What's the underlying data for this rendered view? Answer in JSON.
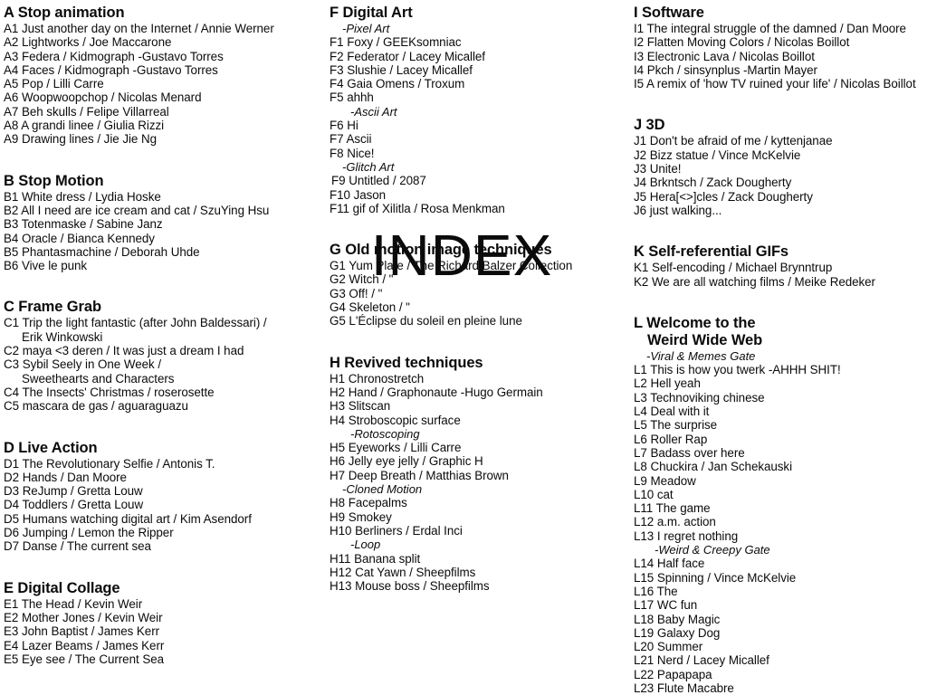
{
  "title": "INDEX",
  "columns": [
    {
      "id": "column-1",
      "sections": [
        {
          "letter": "A",
          "heading": "A Stop animation",
          "entries": [
            {
              "text": "A1 Just another day on the Internet / Annie Werner"
            },
            {
              "text": "A2 Lightworks / Joe Maccarone"
            },
            {
              "text": "A3 Federa / Kidmograph -Gustavo Torres"
            },
            {
              "text": "A4 Faces / Kidmograph -Gustavo Torres"
            },
            {
              "text": "A5 Pop / Lilli Carre"
            },
            {
              "text": "A6 Woopwoopchop / Nicolas Menard"
            },
            {
              "text": "A7 Beh skulls / Felipe Villarreal"
            },
            {
              "text": "A8 A grandi linee / Giulia Rizzi"
            },
            {
              "text": "A9 Drawing lines / Jie Jie Ng"
            }
          ]
        },
        {
          "letter": "B",
          "heading": "B Stop Motion",
          "entries": [
            {
              "text": "B1 White dress / Lydia Hoske"
            },
            {
              "text": "B2 All I need are ice cream and cat / SzuYing Hsu"
            },
            {
              "text": "B3 Totenmaske / Sabine Janz"
            },
            {
              "text": "B4 Oracle / Bianca Kennedy"
            },
            {
              "text": "B5 Phantasmachine / Deborah Uhde"
            },
            {
              "text": "B6 Vive le punk"
            }
          ]
        },
        {
          "letter": "C",
          "heading": "C Frame Grab",
          "entries": [
            {
              "text": "C1 Trip the light fantastic (after John Baldessari) /",
              "cont": "Erik Winkowski"
            },
            {
              "text": "C2 maya <3 deren / It was just a dream I had"
            },
            {
              "text": "C3 Sybil Seely in One Week /",
              "cont": "Sweethearts and Characters"
            },
            {
              "text": "C4 The Insects' Christmas / roserosette"
            },
            {
              "text": "C5 mascara de gas / aguaraguazu"
            }
          ]
        },
        {
          "letter": "D",
          "heading": "D Live Action",
          "entries": [
            {
              "text": "D1 The Revolutionary Selfie / Antonis T."
            },
            {
              "text": "D2 Hands / Dan Moore"
            },
            {
              "text": "D3 ReJump / Gretta Louw"
            },
            {
              "text": "D4 Toddlers / Gretta Louw"
            },
            {
              "text": "D5 Humans watching digital art / Kim Asendorf"
            },
            {
              "text": "D6 Jumping / Lemon the Ripper"
            },
            {
              "text": "D7 Danse / The current sea"
            }
          ]
        },
        {
          "letter": "E",
          "heading": "E Digital Collage",
          "entries": [
            {
              "text": "E1 The Head / Kevin Weir"
            },
            {
              "text": "E2 Mother Jones / Kevin Weir"
            },
            {
              "text": "E3 John Baptist / James Kerr"
            },
            {
              "text": "E4 Lazer Beams / James Kerr"
            },
            {
              "text": "E5 Eye see / The Current Sea"
            }
          ]
        }
      ]
    },
    {
      "id": "column-2",
      "sections": [
        {
          "letter": "F",
          "heading": "F Digital Art",
          "subhead": "-Pixel Art",
          "entries": [
            {
              "text": "F1 Foxy / GEEKsomniac"
            },
            {
              "text": "F2 Federator / Lacey Micallef"
            },
            {
              "text": "F3 Slushie / Lacey Micallef"
            },
            {
              "text": "F4 Gaia Omens / Troxum"
            },
            {
              "text": "F5 ahhh"
            },
            {
              "subhead": "-Ascii Art",
              "deep": true
            },
            {
              "text": "F6 Hi"
            },
            {
              "text": "F7 Ascii"
            },
            {
              "text": "F8 Nice!"
            },
            {
              "subhead": "-Glitch Art"
            },
            {
              "text": "F9 Untitled / 2087",
              "nudge": true
            },
            {
              "text": "F10 Jason"
            },
            {
              "text": "F11 gif of Xilitla / Rosa Menkman"
            }
          ]
        },
        {
          "letter": "G",
          "heading": "G Old motion image techniques",
          "entries": [
            {
              "text": "G1 Yum Plate / The Richard Balzer Collection"
            },
            {
              "text": "G2 Witch / \""
            },
            {
              "text": "G3 Off! / \""
            },
            {
              "text": "G4 Skeleton / \""
            },
            {
              "text": "G5 L'Éclipse du soleil en pleine lune"
            }
          ]
        },
        {
          "letter": "H",
          "heading": "H Revived techniques",
          "entries": [
            {
              "text": "H1 Chronostretch"
            },
            {
              "text": "H2 Hand / Graphonaute -Hugo Germain"
            },
            {
              "text": "H3 Slitscan"
            },
            {
              "text": "H4 Stroboscopic surface"
            },
            {
              "subhead": "-Rotoscoping",
              "deep": true
            },
            {
              "text": "H5 Eyeworks / Lilli Carre"
            },
            {
              "text": "H6 Jelly eye jelly / Graphic H"
            },
            {
              "text": "H7 Deep Breath / Matthias Brown"
            },
            {
              "subhead": "-Cloned Motion"
            },
            {
              "text": "H8 Facepalms"
            },
            {
              "text": "H9 Smokey"
            },
            {
              "text": "H10 Berliners / Erdal Inci"
            },
            {
              "subhead": "-Loop",
              "deep": true
            },
            {
              "text": "H11 Banana split"
            },
            {
              "text": "H12 Cat Yawn / Sheepfilms"
            },
            {
              "text": "H13 Mouse boss / Sheepfilms"
            }
          ]
        }
      ]
    },
    {
      "id": "column-3",
      "sections": [
        {
          "letter": "I",
          "heading": "I Software",
          "entries": [
            {
              "text": "I1 The integral struggle of the damned / Dan Moore"
            },
            {
              "text": "I2 Flatten Moving Colors / Nicolas Boillot"
            },
            {
              "text": "I3 Electronic Lava / Nicolas Boillot"
            },
            {
              "text": "I4 Pkch / sinsynplus -Martin Mayer"
            },
            {
              "text": "I5 A remix of 'how TV ruined your life' / Nicolas Boillot"
            }
          ]
        },
        {
          "letter": "J",
          "heading": "J 3D",
          "entries": [
            {
              "text": "J1 Don't be afraid of me / kyttenjanae"
            },
            {
              "text": "J2 Bizz statue / Vince McKelvie"
            },
            {
              "text": "J3 Unite!"
            },
            {
              "text": "J4 Brkntsch / Zack Dougherty"
            },
            {
              "text": "J5 Hera[<>]cles / Zack Dougherty"
            },
            {
              "text": "J6 just walking..."
            }
          ]
        },
        {
          "letter": "K",
          "heading": "K Self-referential GIFs",
          "entries": [
            {
              "text": "K1 Self-encoding / Michael Brynntrup"
            },
            {
              "text": "K2 We are all watching films / Meike Redeker"
            }
          ]
        },
        {
          "letter": "L",
          "heading": "L Welcome to the",
          "heading_line2": "Weird Wide Web",
          "subhead": "-Viral & Memes Gate",
          "entries": [
            {
              "text": "L1 This is how you twerk -AHHH SHIT!"
            },
            {
              "text": "L2 Hell yeah"
            },
            {
              "text": "L3 Technoviking chinese"
            },
            {
              "text": "L4 Deal with it"
            },
            {
              "text": "L5 The surprise"
            },
            {
              "text": "L6 Roller Rap"
            },
            {
              "text": "L7 Badass over here"
            },
            {
              "text": "L8 Chuckira / Jan Schekauski"
            },
            {
              "text": "L9 Meadow"
            },
            {
              "text": "L10 cat"
            },
            {
              "text": "L11 The game"
            },
            {
              "text": "L12 a.m. action"
            },
            {
              "text": "L13 I regret nothing"
            },
            {
              "subhead": "-Weird & Creepy Gate",
              "deep": true
            },
            {
              "text": "L14 Half face"
            },
            {
              "text": "L15 Spinning / Vince McKelvie"
            },
            {
              "text": "L16 The"
            },
            {
              "text": "L17 WC fun"
            },
            {
              "text": "L18 Baby Magic"
            },
            {
              "text": "L19 Galaxy Dog"
            },
            {
              "text": "L20 Summer"
            },
            {
              "text": "L21 Nerd / Lacey Micallef"
            },
            {
              "text": "L22 Papapapa"
            },
            {
              "text": "L23 Flute Macabre"
            }
          ]
        }
      ]
    }
  ]
}
